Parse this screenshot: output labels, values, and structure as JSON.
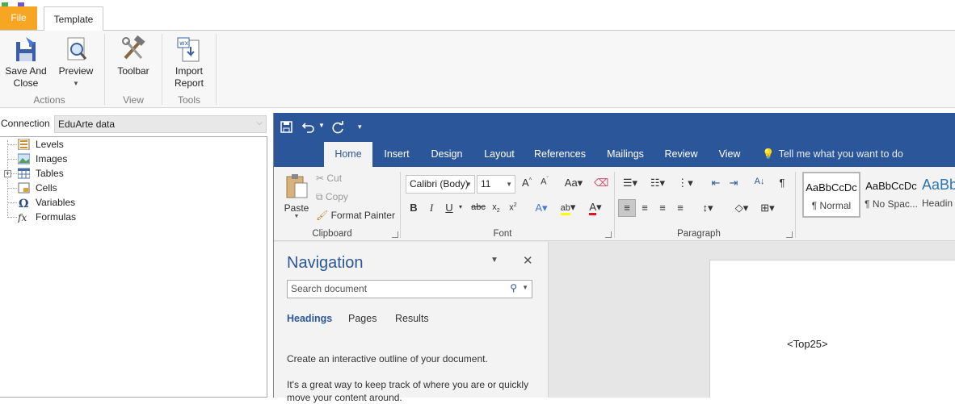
{
  "app": {
    "tabs": [
      {
        "label": "File"
      },
      {
        "label": "Template"
      }
    ],
    "ribbon": {
      "actions": {
        "save_label": "Save And\nClose",
        "save_l1": "Save And",
        "save_l2": "Close",
        "preview_label": "Preview",
        "group": "Actions"
      },
      "view": {
        "toolbar_label": "Toolbar",
        "group": "View"
      },
      "tools": {
        "import_l1": "Import",
        "import_l2": "Report",
        "group": "Tools"
      }
    }
  },
  "connection": {
    "label": "Connection",
    "value": "EduArte data"
  },
  "tree": {
    "items": [
      {
        "label": "Levels",
        "icon": "levels-icon"
      },
      {
        "label": "Images",
        "icon": "images-icon"
      },
      {
        "label": "Tables",
        "icon": "tables-icon"
      },
      {
        "label": "Cells",
        "icon": "cells-icon"
      },
      {
        "label": "Variables",
        "icon": "omega-icon"
      },
      {
        "label": "Formulas",
        "icon": "fx-icon"
      }
    ]
  },
  "word": {
    "tabs": [
      {
        "label": "Home"
      },
      {
        "label": "Insert"
      },
      {
        "label": "Design"
      },
      {
        "label": "Layout"
      },
      {
        "label": "References"
      },
      {
        "label": "Mailings"
      },
      {
        "label": "Review"
      },
      {
        "label": "View"
      }
    ],
    "tell_me": "Tell me what you want to do",
    "clipboard": {
      "paste": "Paste",
      "cut": "Cut",
      "copy": "Copy",
      "format_painter": "Format Painter",
      "group": "Clipboard"
    },
    "font": {
      "name": "Calibri (Body)",
      "size": "11",
      "group": "Font"
    },
    "paragraph": {
      "group": "Paragraph"
    },
    "styles": [
      {
        "sample": "AaBbCcDc",
        "name": "¶ Normal"
      },
      {
        "sample": "AaBbCcDc",
        "name": "¶ No Spac..."
      },
      {
        "sample": "AaBb",
        "name": "Headin"
      }
    ],
    "colors": {
      "accent": "#2b579a",
      "highlight": "#ffff00",
      "font_color": "#e81123"
    }
  },
  "navigation": {
    "title": "Navigation",
    "search_placeholder": "Search document",
    "tabs": [
      {
        "label": "Headings"
      },
      {
        "label": "Pages"
      },
      {
        "label": "Results"
      }
    ],
    "text1": "Create an interactive outline of your document.",
    "text2": "It's a great way to keep track of where you are or quickly move your content around."
  },
  "document": {
    "field": "<Top25>"
  }
}
